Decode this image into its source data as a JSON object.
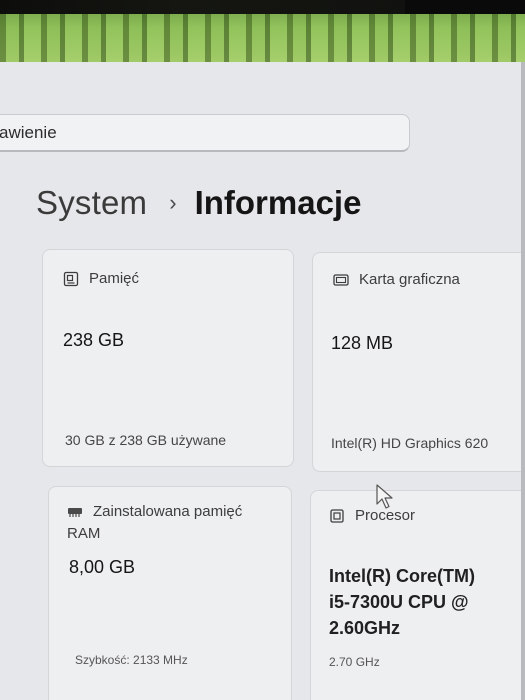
{
  "search": {
    "value": "awienie"
  },
  "breadcrumb": {
    "parent": "System",
    "separator": "›",
    "current": "Informacje"
  },
  "cards": {
    "memory": {
      "icon": "storage-icon",
      "label": "Pamięć",
      "value": "238 GB",
      "sub": "30 GB z 238 GB używane"
    },
    "gpu": {
      "icon": "display-adapter-icon",
      "label": "Karta graficzna",
      "value": "128 MB",
      "sub": "Intel(R) HD Graphics 620"
    },
    "ram": {
      "icon": "ram-icon",
      "label_line1": "Zainstalowana pamięć",
      "label_line2": "RAM",
      "value": "8,00 GB",
      "sub": "Szybkość: 2133 MHz"
    },
    "cpu": {
      "icon": "processor-icon",
      "label": "Procesor",
      "value_line1": "Intel(R) Core(TM)",
      "value_line2": "i5-7300U CPU @",
      "value_line3": "2.60GHz",
      "sub": "2.70 GHz"
    }
  },
  "colors": {
    "window_bg": "#e6e7ea",
    "card_bg": "#eeeff1",
    "text_primary": "#151515",
    "text_secondary": "#454545"
  }
}
